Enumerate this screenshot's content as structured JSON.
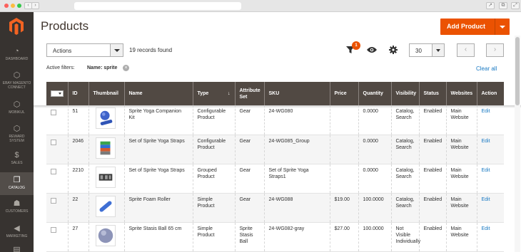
{
  "browser": {
    "back_label": "‹",
    "forward_label": "›",
    "action_1": "↗",
    "action_2": "⧉",
    "action_3": "⤢",
    "dot_colors": [
      "#fc615d",
      "#fdbc40",
      "#34c84a"
    ]
  },
  "sidebar": {
    "logo": "magento-logo-icon",
    "items": [
      {
        "label": "DASHBOARD",
        "icon": "speedometer-icon",
        "glyph": "◔"
      },
      {
        "label": "EBAY MAGENTO CONNECT",
        "icon": "hexagon-icon",
        "glyph": "⬡"
      },
      {
        "label": "MOBIKUL",
        "icon": "hexagon-icon",
        "glyph": "⬡"
      },
      {
        "label": "REWARD SYSTEM",
        "icon": "hexagon-icon",
        "glyph": "⬡"
      },
      {
        "label": "SALES",
        "icon": "dollar-icon",
        "glyph": "$"
      },
      {
        "label": "CATALOG",
        "icon": "cube-icon",
        "glyph": "❒"
      },
      {
        "label": "CUSTOMERS",
        "icon": "person-icon",
        "glyph": "☗"
      },
      {
        "label": "MARKETING",
        "icon": "megaphone-icon",
        "glyph": "◀"
      },
      {
        "label": "",
        "icon": "content-icon",
        "glyph": "▤"
      }
    ]
  },
  "header": {
    "title": "Products",
    "add_button": "Add Product"
  },
  "toolbar": {
    "actions_label": "Actions",
    "records": "19 records found",
    "filter_count": "1",
    "per_page": "30",
    "prev": "‹",
    "next": "›"
  },
  "filters": {
    "label": "Active filters:",
    "chip": "Name: sprite",
    "chip_remove": "×",
    "clear_all": "Clear all"
  },
  "grid": {
    "columns": [
      "",
      "ID",
      "Thumbnail",
      "Name",
      "Type",
      "Attribute Set",
      "SKU",
      "Price",
      "Quantity",
      "Visibility",
      "Status",
      "Websites",
      "Action"
    ],
    "sort_indicator": "↓",
    "rows": [
      {
        "id": "51",
        "name": "Sprite Yoga Companion Kit",
        "type": "Configurable Product",
        "attr": "Gear",
        "sku": "24-WG080",
        "price": "",
        "qty": "0.0000",
        "visibility": "Catalog, Search",
        "status": "Enabled",
        "websites": "Main Website",
        "action": "Edit",
        "thumb": "kit"
      },
      {
        "id": "2046",
        "name": "Set of Sprite Yoga Straps",
        "type": "Configurable Product",
        "attr": "Gear",
        "sku": "24-WG085_Group",
        "price": "",
        "qty": "0.0000",
        "visibility": "Catalog, Search",
        "status": "Enabled",
        "websites": "Main Website",
        "action": "Edit",
        "thumb": "straps"
      },
      {
        "id": "2210",
        "name": "Set of Sprite Yoga Straps",
        "type": "Grouped Product",
        "attr": "Gear",
        "sku": "Set of Sprite Yoga Straps1",
        "price": "",
        "qty": "0.0000",
        "visibility": "Catalog, Search",
        "status": "Enabled",
        "websites": "Main Website",
        "action": "Edit",
        "thumb": "strapsdark"
      },
      {
        "id": "22",
        "name": "Sprite Foam Roller",
        "type": "Simple Product",
        "attr": "Gear",
        "sku": "24-WG088",
        "price": "$19.00",
        "qty": "100.0000",
        "visibility": "Catalog, Search",
        "status": "Enabled",
        "websites": "Main Website",
        "action": "Edit",
        "thumb": "roller"
      },
      {
        "id": "27",
        "name": "Sprite Stasis Ball 65 cm",
        "type": "Simple Product",
        "attr": "Sprite Stasis Ball",
        "sku": "24-WG082-gray",
        "price": "$27.00",
        "qty": "100.0000",
        "visibility": "Not Visible Individually",
        "status": "Enabled",
        "websites": "Main Website",
        "action": "Edit",
        "thumb": "ball"
      }
    ]
  }
}
